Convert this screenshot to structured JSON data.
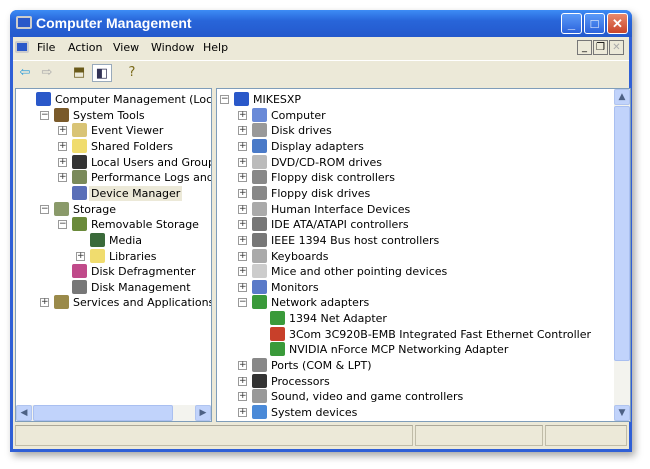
{
  "window": {
    "title": "Computer Management"
  },
  "menu": [
    "File",
    "Action",
    "View",
    "Window",
    "Help"
  ],
  "left_tree": [
    {
      "label": "Computer Management (Local)",
      "level": 0,
      "toggle": "",
      "color": "#2a58c9"
    },
    {
      "label": "System Tools",
      "level": 1,
      "toggle": "-",
      "color": "#7a5a2a"
    },
    {
      "label": "Event Viewer",
      "level": 2,
      "toggle": "+",
      "color": "#d9c476"
    },
    {
      "label": "Shared Folders",
      "level": 2,
      "toggle": "+",
      "color": "#f0dc6e"
    },
    {
      "label": "Local Users and Groups",
      "level": 2,
      "toggle": "+",
      "color": "#333333"
    },
    {
      "label": "Performance Logs and Alerts",
      "level": 2,
      "toggle": "+",
      "color": "#7a8a5a"
    },
    {
      "label": "Device Manager",
      "level": 2,
      "toggle": "",
      "color": "#5a6fb8",
      "selected": true
    },
    {
      "label": "Storage",
      "level": 1,
      "toggle": "-",
      "color": "#8a9a6a"
    },
    {
      "label": "Removable Storage",
      "level": 2,
      "toggle": "-",
      "color": "#6a8a3a"
    },
    {
      "label": "Media",
      "level": 3,
      "toggle": "",
      "color": "#3a6a3a"
    },
    {
      "label": "Libraries",
      "level": 3,
      "toggle": "+",
      "color": "#f0dc6e"
    },
    {
      "label": "Disk Defragmenter",
      "level": 2,
      "toggle": "",
      "color": "#c04a8a"
    },
    {
      "label": "Disk Management",
      "level": 2,
      "toggle": "",
      "color": "#777777"
    },
    {
      "label": "Services and Applications",
      "level": 1,
      "toggle": "+",
      "color": "#9a8a4a"
    }
  ],
  "right_tree": [
    {
      "label": "MIKESXP",
      "level": 0,
      "toggle": "-",
      "color": "#2a58c9"
    },
    {
      "label": "Computer",
      "level": 1,
      "toggle": "+",
      "color": "#6a8ad8"
    },
    {
      "label": "Disk drives",
      "level": 1,
      "toggle": "+",
      "color": "#999999"
    },
    {
      "label": "Display adapters",
      "level": 1,
      "toggle": "+",
      "color": "#4a7ac8"
    },
    {
      "label": "DVD/CD-ROM drives",
      "level": 1,
      "toggle": "+",
      "color": "#bbbbbb"
    },
    {
      "label": "Floppy disk controllers",
      "level": 1,
      "toggle": "+",
      "color": "#888888"
    },
    {
      "label": "Floppy disk drives",
      "level": 1,
      "toggle": "+",
      "color": "#888888"
    },
    {
      "label": "Human Interface Devices",
      "level": 1,
      "toggle": "+",
      "color": "#aaaaaa"
    },
    {
      "label": "IDE ATA/ATAPI controllers",
      "level": 1,
      "toggle": "+",
      "color": "#777777"
    },
    {
      "label": "IEEE 1394 Bus host controllers",
      "level": 1,
      "toggle": "+",
      "color": "#777777"
    },
    {
      "label": "Keyboards",
      "level": 1,
      "toggle": "+",
      "color": "#aaaaaa"
    },
    {
      "label": "Mice and other pointing devices",
      "level": 1,
      "toggle": "+",
      "color": "#cccccc"
    },
    {
      "label": "Monitors",
      "level": 1,
      "toggle": "+",
      "color": "#5a7ac8"
    },
    {
      "label": "Network adapters",
      "level": 1,
      "toggle": "-",
      "color": "#3a9a3a"
    },
    {
      "label": "1394 Net Adapter",
      "level": 2,
      "toggle": "",
      "color": "#3a9a3a"
    },
    {
      "label": "3Com 3C920B-EMB Integrated Fast Ethernet Controller",
      "level": 2,
      "toggle": "",
      "color": "#c8402a"
    },
    {
      "label": "NVIDIA nForce MCP Networking Adapter",
      "level": 2,
      "toggle": "",
      "color": "#3a9a3a"
    },
    {
      "label": "Ports (COM & LPT)",
      "level": 1,
      "toggle": "+",
      "color": "#888888"
    },
    {
      "label": "Processors",
      "level": 1,
      "toggle": "+",
      "color": "#333333"
    },
    {
      "label": "Sound, video and game controllers",
      "level": 1,
      "toggle": "+",
      "color": "#999999"
    },
    {
      "label": "System devices",
      "level": 1,
      "toggle": "+",
      "color": "#4a8ad8"
    }
  ]
}
